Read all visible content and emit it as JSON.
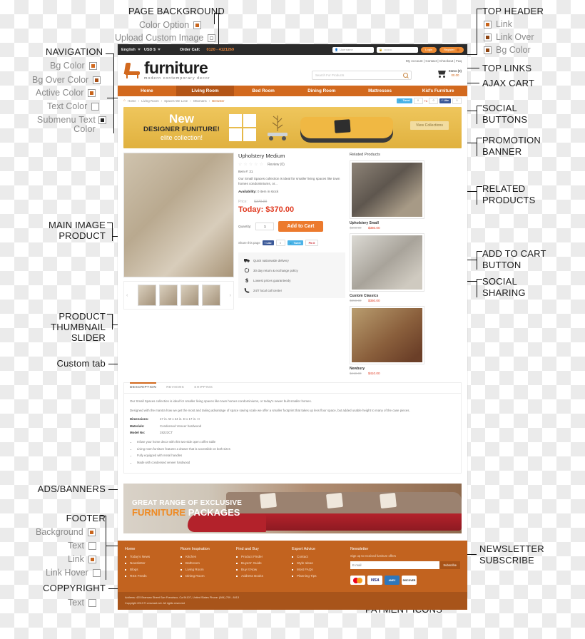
{
  "annotations": {
    "page_background": {
      "title": "PAGE BACKGROUND",
      "options": [
        {
          "label": "Color Option",
          "swatch": "color",
          "color": "#c8641b"
        },
        {
          "label": "Upload Custom Image",
          "swatch": "image",
          "color": "#ffffff"
        }
      ]
    },
    "navigation": {
      "title": "NAVIGATION",
      "options": [
        {
          "label": "Bg Color",
          "swatch": "color",
          "color": "#d2691e"
        },
        {
          "label": "Bg Over Color",
          "swatch": "color",
          "color": "#a84e14"
        },
        {
          "label": "Active Color",
          "swatch": "color",
          "color": "#c8641b"
        },
        {
          "label": "Text Color",
          "swatch": "empty",
          "color": "#ffffff"
        },
        {
          "label": "Submenu Text Color",
          "swatch": "color",
          "color": "#222222"
        }
      ]
    },
    "top_header": {
      "title": "TOP HEADER",
      "options": [
        {
          "label": "Link",
          "swatch": "color",
          "color": "#c8641b"
        },
        {
          "label": "Link Over",
          "swatch": "color",
          "color": "#8f4410"
        },
        {
          "label": "Bg Color",
          "swatch": "color",
          "color": "#8f4410"
        }
      ]
    },
    "footer": {
      "title": "FOOTER",
      "options": [
        {
          "label": "Background",
          "swatch": "color",
          "color": "#c8641b"
        },
        {
          "label": "Text",
          "swatch": "empty",
          "color": "#ffffff"
        },
        {
          "label": "Link",
          "swatch": "color",
          "color": "#c8641b"
        },
        {
          "label": "Link Hover",
          "swatch": "empty",
          "color": "#ffffff"
        }
      ]
    },
    "copyright": {
      "title": "COPPYRIGHT",
      "options": [
        {
          "label": "Text",
          "swatch": "empty",
          "color": "#ffffff"
        }
      ]
    },
    "callouts": {
      "top_links": "TOP LINKS",
      "ajax_cart": "AJAX CART",
      "social_buttons_l1": "SOCIAL",
      "social_buttons_l2": "BUTTONS",
      "promotion_l1": "PROMOTION",
      "promotion_l2": "BANNER",
      "related_l1": "RELATED",
      "related_l2": "PRODUCTS",
      "add_to_cart_l1": "ADD TO CART",
      "add_to_cart_l2": "BUTTON",
      "social_sharing_l1": "SOCIAL",
      "social_sharing_l2": "SHARING",
      "main_image_l1": "MAIN IMAGE",
      "main_image_l2": "PRODUCT",
      "thumb_l1": "PRODUCT",
      "thumb_l2": "THUMBNAIL",
      "thumb_l3": "SLIDER",
      "custom_tab": "Custom tab",
      "ads_banners": "ADS/BANNERS",
      "newsletter_l1": "NEWSLETTER",
      "newsletter_l2": "SUBSCRIBE",
      "payment_icons": "PAYMENT ICONS"
    }
  },
  "site": {
    "topbar": {
      "language": "English",
      "currency": "USD $",
      "order_call_label": "Order Call:",
      "phone": "0120 - 4121269",
      "username_placeholder": "Username",
      "password_value": "••••••••",
      "login_label": "Login",
      "register_label": "Register"
    },
    "brand": {
      "name": "furniture",
      "tagline": "modern contemporary decor"
    },
    "top_links": [
      "My Account",
      "Contact",
      "Checkout",
      "Faq"
    ],
    "search": {
      "placeholder": "Search For Products"
    },
    "cart": {
      "items_label": "Items (0)",
      "total": "00.00"
    },
    "nav": [
      {
        "label": "Home",
        "active": false
      },
      {
        "label": "Living Room",
        "active": true
      },
      {
        "label": "Bed Room",
        "active": false
      },
      {
        "label": "Dining Room",
        "active": false
      },
      {
        "label": "Mattresses",
        "active": false
      },
      {
        "label": "Kid's Furniture",
        "active": false
      }
    ],
    "breadcrumb": [
      "Home",
      "Living Room",
      "Spaces We Love",
      "Ottomans",
      "Brewster"
    ],
    "social_buttons": {
      "tweet": "Tweet",
      "tweet_count": "0",
      "gplus": "+1",
      "gplus_count": "0",
      "like": "Like",
      "like_count": "0"
    },
    "promo": {
      "line1": "New",
      "line2": "DESIGNER FUNITURE!",
      "line3": "elite collection!",
      "button": "View Collections"
    },
    "product": {
      "title": "Upholstery Medium",
      "review": "Review (0)",
      "item_no": "Item #: 21",
      "description": "Our Small Spaces collection is ideal for smaller living spaces like town homes condominiums, or...",
      "availability_label": "Availability:",
      "availability_value": "0 item in stock",
      "price_label": "Price:",
      "price_old": "$370.00",
      "price_today": "Today: $370.00",
      "quantity_label": "Quantity:",
      "quantity_value": "1",
      "add_to_cart": "Add to Cart",
      "share_label": "Share this page",
      "share_like": "Like",
      "share_like_count": "0",
      "share_tweet": "Tweet",
      "share_pin": "Pin it"
    },
    "services": [
      {
        "icon": "truck-icon",
        "text": "Quick nationwide delivery"
      },
      {
        "icon": "refresh-icon",
        "text": "30 day return & exchange policy"
      },
      {
        "icon": "dollar-icon",
        "text": "Lowest prices guaranteedy"
      },
      {
        "icon": "phone-icon",
        "text": "24/7 local call center"
      }
    ],
    "related": {
      "title": "Related Products",
      "items": [
        {
          "name": "Upholstery Small",
          "old_price": "$360.00",
          "new_price": "$360.00"
        },
        {
          "name": "Custom Classics",
          "old_price": "$350.00",
          "new_price": "$350.00"
        },
        {
          "name": "Newbury",
          "old_price": "$410.00",
          "new_price": "$410.00"
        }
      ]
    },
    "tabs": {
      "items": [
        {
          "label": "DESCRIPTION",
          "active": true
        },
        {
          "label": "REVIEWS",
          "active": false
        },
        {
          "label": "SHIPPING",
          "active": false
        }
      ],
      "paragraph1": "Our Small Spaces collection is ideal for smaller living spaces like town homes condominiums, or today's newer built smaller homes.",
      "paragraph2": "Designed with the mantra how we get the most and taking advantage of space saving scale we offer a smaller footprint that takes up less floor space, but added usable height to many of the case pieces.",
      "specs": [
        {
          "label": "Dimensions:",
          "value": "47 in. W x 24 in. D x 17 in. H"
        },
        {
          "label": "Materials:",
          "value": "Condensed Veneer hardwood"
        },
        {
          "label": "Model No:",
          "value": "28223CT"
        }
      ],
      "bullets": [
        "Infuse your home decor with this two-side open coffee table",
        "Living room furniture features a drawer that is accessible on both sizes",
        "Fully equipped with metal handles",
        "Made with condensed veneer hardwood"
      ]
    },
    "ad_banner": {
      "line1": "GREAT RANGE OF EXCLUSIVE",
      "line2_accent": "FURNITURE",
      "line2_rest": "PACKAGES"
    },
    "footer": {
      "columns": [
        {
          "heading": "Home",
          "links": [
            "Today's News",
            "Newsletter",
            "Blogs",
            "RSS Feeds"
          ]
        },
        {
          "heading": "Room Inspiration",
          "links": [
            "Kitchen",
            "Bathroom",
            "Living Room",
            "Dining Room"
          ]
        },
        {
          "heading": "Find and Buy",
          "links": [
            "Product Finder",
            "Buyers' Guide",
            "Buy It Now",
            "Address Books"
          ]
        },
        {
          "heading": "Expert Advice",
          "links": [
            "Contact",
            "Style Ideas",
            "Most FAQs",
            "Planning Tips"
          ]
        }
      ],
      "newsletter": {
        "heading": "Newsletter",
        "subtext": "Sign up to received furniture offers",
        "placeholder": "E-mail",
        "button": "Subscribe"
      },
      "payments": [
        "MasterCard",
        "VISA",
        "AMEX",
        "DISCOVER"
      ]
    },
    "copyright": {
      "address": "Address:  425 Brannan Street San Francisco, Ca 94107, United States     Phone: (084) 709 - 8413",
      "line2": "Copyright 2013 © cmsmart.net. All rights reserved"
    }
  }
}
